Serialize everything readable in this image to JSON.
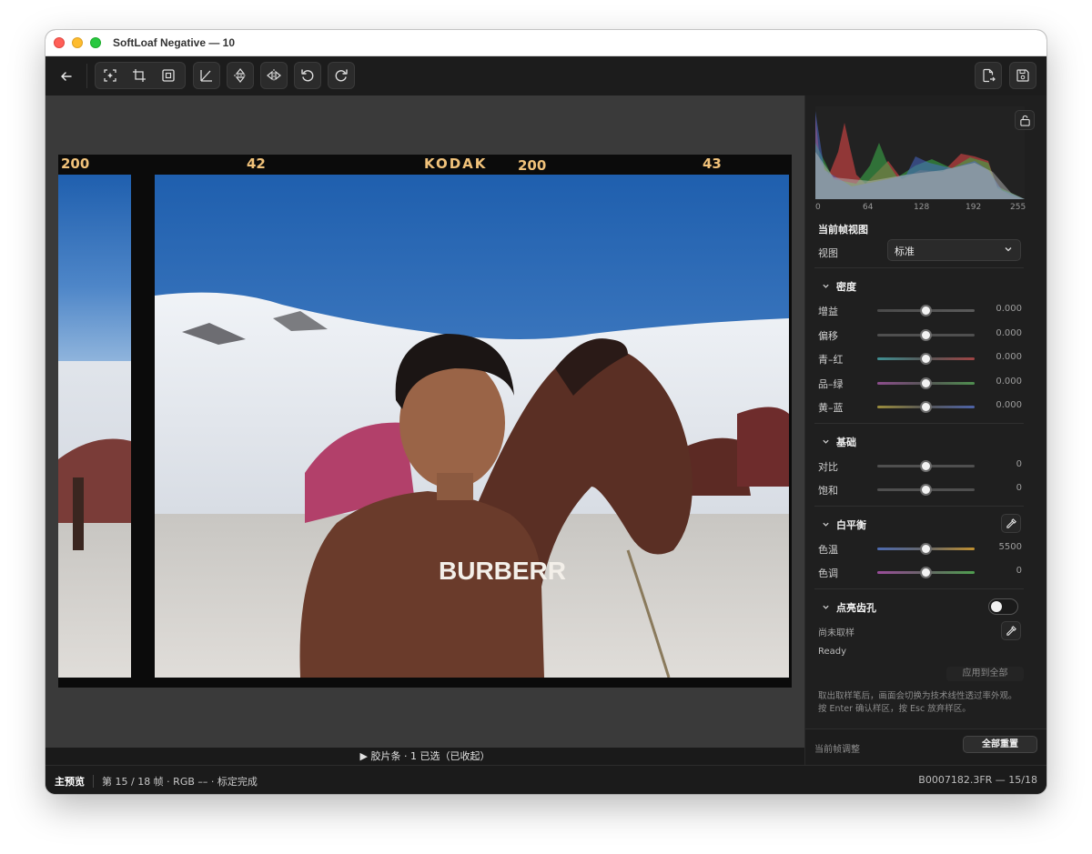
{
  "window": {
    "title": "SoftLoaf Negative — 10"
  },
  "toolbar": {
    "back_icon": "arrow-left-icon",
    "group_icons": [
      "auto-frame-icon",
      "crop-icon",
      "focus-frame-icon"
    ],
    "tools": [
      "angle-icon",
      "flip-vertical-icon",
      "flip-horizontal-icon",
      "rotate-left-icon",
      "rotate-right-icon"
    ],
    "right": [
      "export-file-icon",
      "save-icon"
    ]
  },
  "film": {
    "edge_labels": [
      "200",
      "42",
      "KODAK",
      "200",
      "43"
    ]
  },
  "filmstrip": {
    "label": "▶  胶片条 · 1 已选（已收起）"
  },
  "status": {
    "main": "主预览",
    "info": "第 15 / 18 帧 · RGB ––   · 标定完成",
    "file": "B0007182.3FR — 15/18"
  },
  "panel": {
    "histogram_ticks": [
      "0",
      "64",
      "128",
      "192",
      "255"
    ],
    "view_section": {
      "title": "当前帧视图",
      "label": "视图",
      "value": "标准"
    },
    "density": {
      "title": "密度",
      "rows": [
        {
          "label": "增益",
          "value": "0.000"
        },
        {
          "label": "偏移",
          "value": "0.000"
        },
        {
          "label": "青–红",
          "value": "0.000"
        },
        {
          "label": "品–绿",
          "value": "0.000"
        },
        {
          "label": "黄–蓝",
          "value": "0.000"
        }
      ]
    },
    "basic": {
      "title": "基础",
      "rows": [
        {
          "label": "对比",
          "value": "0"
        },
        {
          "label": "饱和",
          "value": "0"
        }
      ]
    },
    "white_balance": {
      "title": "白平衡",
      "rows": [
        {
          "label": "色温",
          "value": "5500"
        },
        {
          "label": "色调",
          "value": "0"
        }
      ]
    },
    "dust": {
      "title": "点亮齿孔",
      "toggle_on": false,
      "not_sampled": "尚未取样",
      "state": "Ready",
      "apply_all": "应用到全部",
      "hint": "取出取样笔后，画面会切换为技术线性透过率外观。按 Enter 确认样区，按 Esc 放弃样区。"
    },
    "footer": {
      "label": "当前帧调整",
      "reset_all": "全部重置"
    }
  }
}
